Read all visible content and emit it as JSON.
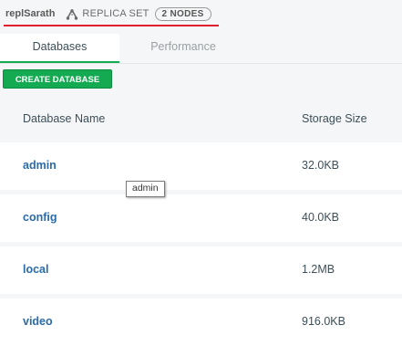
{
  "header": {
    "cluster_name": "replSarath",
    "replica_set_label": "REPLICA SET",
    "nodes_badge": "2 NODES"
  },
  "tabs": [
    {
      "label": "Databases",
      "active": true
    },
    {
      "label": "Performance",
      "active": false
    }
  ],
  "create_button_label": "CREATE DATABASE",
  "table": {
    "columns": [
      "Database Name",
      "Storage Size"
    ],
    "rows": [
      {
        "name": "admin",
        "size": "32.0KB"
      },
      {
        "name": "config",
        "size": "40.0KB"
      },
      {
        "name": "local",
        "size": "1.2MB"
      },
      {
        "name": "video",
        "size": "916.0KB"
      }
    ]
  },
  "tooltip": "admin",
  "colors": {
    "accent_green": "#13aa52",
    "link_blue": "#2a6ba8",
    "underline_red": "#e0202e"
  },
  "icons": [
    "replica-set-icon"
  ]
}
